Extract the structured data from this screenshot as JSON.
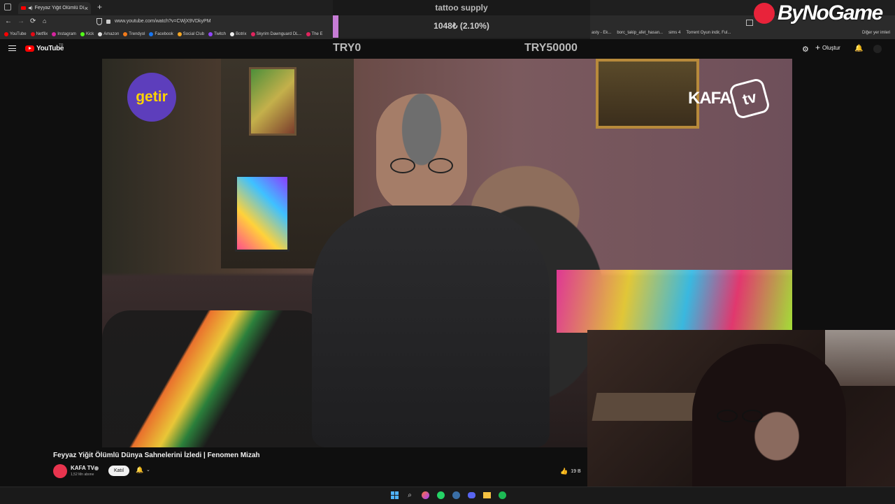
{
  "browser": {
    "tab_title": "Feyyaz Yiğit Ölümlü Dünya",
    "tab_close": "×",
    "new_tab": "+",
    "url": "www.youtube.com/watch?v=CWjX9VDkyPM",
    "bookmarks": [
      "YouTube",
      "Netflix",
      "Instagram",
      "Kick",
      "Amazon",
      "Trendyol",
      "Facebook",
      "Social Club",
      "Twitch",
      "Botrix",
      "Skyrim Dawnguard DL...",
      "The E"
    ],
    "bookmarks_right": [
      "asty - Ek...",
      "borc_takip_afet_hasan...",
      "sims 4",
      "Torrent Oyun indir, Ful..."
    ],
    "other_bookmarks": "Diğer yer imleri"
  },
  "overlay": {
    "title": "tattoo supply",
    "progress_text": "1048₺ (2.10%)",
    "goal_start": "TRY0",
    "goal_end": "TRY50000",
    "progress_fraction": 0.021,
    "brand": "ByNoGame"
  },
  "youtube": {
    "logo_text": "YouTube",
    "logo_sup": "TR",
    "create_label": "Oluştur"
  },
  "video": {
    "sponsor_logo": "getir",
    "channel_watermark": "KAFA",
    "channel_watermark_tv": "tv",
    "title": "Feyyaz Yiğit Ölümlü Dünya Sahnelerini İzledi | Fenomen Mizah",
    "channel_name": "KAFA TV",
    "subscribers": "1,52 Mn abone",
    "join_label": "Katıl",
    "likes": "19 B"
  },
  "colors": {
    "youtube_red": "#ff0000",
    "getir_purple": "#5d3ebc",
    "overlay_accent": "#c77dd6"
  }
}
